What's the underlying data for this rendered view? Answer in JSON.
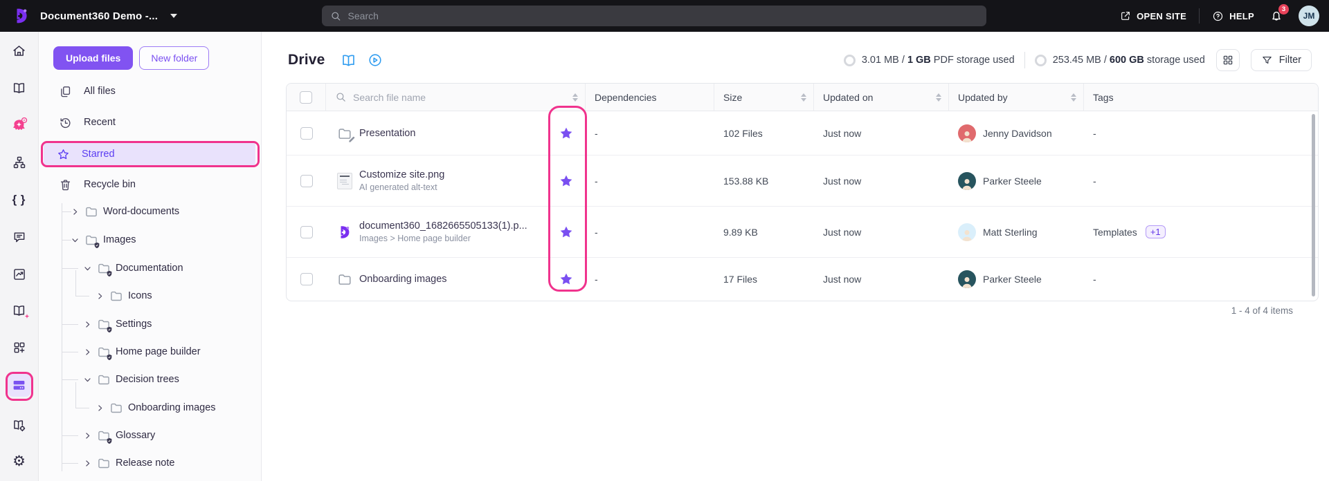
{
  "topbar": {
    "app_title": "Document360 Demo -...",
    "search_placeholder": "Search",
    "open_site_label": "OPEN SITE",
    "help_label": "HELP",
    "notification_count": "3",
    "avatar_initials": "JM"
  },
  "rail_icons": [
    "home-icon",
    "knowledge-base-icon",
    "eddy-ai-icon",
    "workflow-icon",
    "api-docs-icon",
    "feedback-icon",
    "analytics-icon",
    "documentation-ai-icon",
    "widgets-icon",
    "drive-icon",
    "knowledge-base-settings-icon",
    "settings-icon"
  ],
  "sidebar": {
    "upload_button": "Upload files",
    "new_folder_button": "New folder",
    "nav": [
      {
        "label": "All files"
      },
      {
        "label": "Recent"
      },
      {
        "label": "Starred",
        "active": true
      },
      {
        "label": "Recycle bin"
      }
    ],
    "tree": [
      {
        "label": "Word-documents",
        "level": 0,
        "expanded": false,
        "protected": false
      },
      {
        "label": "Images",
        "level": 0,
        "expanded": true,
        "protected": true
      },
      {
        "label": "Documentation",
        "level": 1,
        "expanded": true,
        "protected": true
      },
      {
        "label": "Icons",
        "level": 2,
        "expanded": false,
        "protected": false
      },
      {
        "label": "Settings",
        "level": 1,
        "expanded": false,
        "protected": true
      },
      {
        "label": "Home page builder",
        "level": 1,
        "expanded": false,
        "protected": true
      },
      {
        "label": "Decision trees",
        "level": 1,
        "expanded": true,
        "protected": false
      },
      {
        "label": "Onboarding images",
        "level": 2,
        "expanded": false,
        "protected": false
      },
      {
        "label": "Glossary",
        "level": 1,
        "expanded": false,
        "protected": true
      },
      {
        "label": "Release note",
        "level": 1,
        "expanded": false,
        "protected": false
      }
    ]
  },
  "main": {
    "title": "Drive",
    "storage": [
      {
        "used": "3.01 MB / ",
        "total": "1 GB",
        "suffix": " PDF storage used"
      },
      {
        "used": "253.45 MB / ",
        "total": "600 GB",
        "suffix": " storage used"
      }
    ],
    "filter_button": "Filter",
    "table": {
      "search_placeholder": "Search file name",
      "columns": {
        "dependencies": "Dependencies",
        "size": "Size",
        "updated_on": "Updated on",
        "updated_by": "Updated by",
        "tags": "Tags"
      },
      "rows": [
        {
          "name": "Presentation",
          "icon": "folder-edit-icon",
          "starred": true,
          "dependencies": "-",
          "size": "102 Files",
          "updated_on": "Just now",
          "updated_by": "Jenny Davidson",
          "tags": "-"
        },
        {
          "name": "Customize site.png",
          "subtitle": "AI generated alt-text",
          "icon": "image-thumbnail",
          "starred": true,
          "dependencies": "-",
          "size": "153.88 KB",
          "updated_on": "Just now",
          "updated_by": "Parker Steele",
          "tags": "-"
        },
        {
          "name": "document360_1682665505133(1).p...",
          "subtitle": "Images > Home page builder",
          "icon": "document360-file-icon",
          "starred": true,
          "dependencies": "-",
          "size": "9.89 KB",
          "updated_on": "Just now",
          "updated_by": "Matt Sterling",
          "tags": "Templates",
          "tags_badge": "+1"
        },
        {
          "name": "Onboarding images",
          "icon": "folder-icon",
          "starred": true,
          "dependencies": "-",
          "size": "17 Files",
          "updated_on": "Just now",
          "updated_by": "Parker Steele",
          "tags": "-"
        }
      ],
      "footer": "1 - 4 of 4 items"
    }
  },
  "colors": {
    "accent_purple": "#8153f1",
    "star_purple": "#7a4ff1",
    "annotation_pink": "#f0338d",
    "link_blue": "#2f9cf0",
    "notification_red": "#e8425a",
    "topbar_bg": "#141418"
  }
}
